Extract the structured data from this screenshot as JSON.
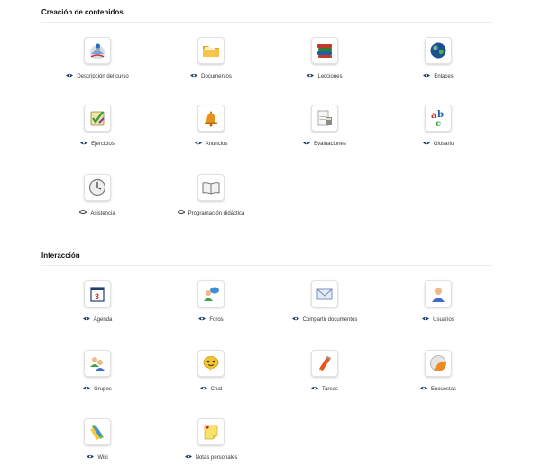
{
  "sections": [
    {
      "title": "Creación de contenidos",
      "tools": [
        {
          "label": "Descripción del curso",
          "visibility": "visible",
          "icon": "course-description-icon"
        },
        {
          "label": "Documentos",
          "visibility": "visible",
          "icon": "folder-icon"
        },
        {
          "label": "Lecciones",
          "visibility": "visible",
          "icon": "books-icon"
        },
        {
          "label": "Enlaces",
          "visibility": "visible",
          "icon": "globe-icon"
        },
        {
          "label": "Ejercicios",
          "visibility": "visible",
          "icon": "exercise-icon"
        },
        {
          "label": "Anuncios",
          "visibility": "visible",
          "icon": "bell-icon"
        },
        {
          "label": "Evaluaciones",
          "visibility": "visible",
          "icon": "calculator-icon"
        },
        {
          "label": "Glosario",
          "visibility": "visible",
          "icon": "abc-icon"
        },
        {
          "label": "Asistencia",
          "visibility": "hidden",
          "icon": "clock-icon"
        },
        {
          "label": "Programación didáctica",
          "visibility": "hidden",
          "icon": "open-book-icon"
        }
      ]
    },
    {
      "title": "Interacción",
      "tools": [
        {
          "label": "Agenda",
          "visibility": "visible",
          "icon": "calendar-icon"
        },
        {
          "label": "Foros",
          "visibility": "visible",
          "icon": "forum-icon"
        },
        {
          "label": "Compartir documentos",
          "visibility": "visible",
          "icon": "envelope-icon"
        },
        {
          "label": "Usuarios",
          "visibility": "visible",
          "icon": "user-icon"
        },
        {
          "label": "Grupos",
          "visibility": "visible",
          "icon": "group-icon"
        },
        {
          "label": "Chat",
          "visibility": "visible",
          "icon": "chat-icon"
        },
        {
          "label": "Tareas",
          "visibility": "visible",
          "icon": "pencil-icon"
        },
        {
          "label": "Encuestas",
          "visibility": "visible",
          "icon": "survey-icon"
        },
        {
          "label": "Wiki",
          "visibility": "visible",
          "icon": "wiki-icon"
        },
        {
          "label": "Notas personales",
          "visibility": "visible",
          "icon": "sticky-note-icon"
        }
      ]
    }
  ]
}
